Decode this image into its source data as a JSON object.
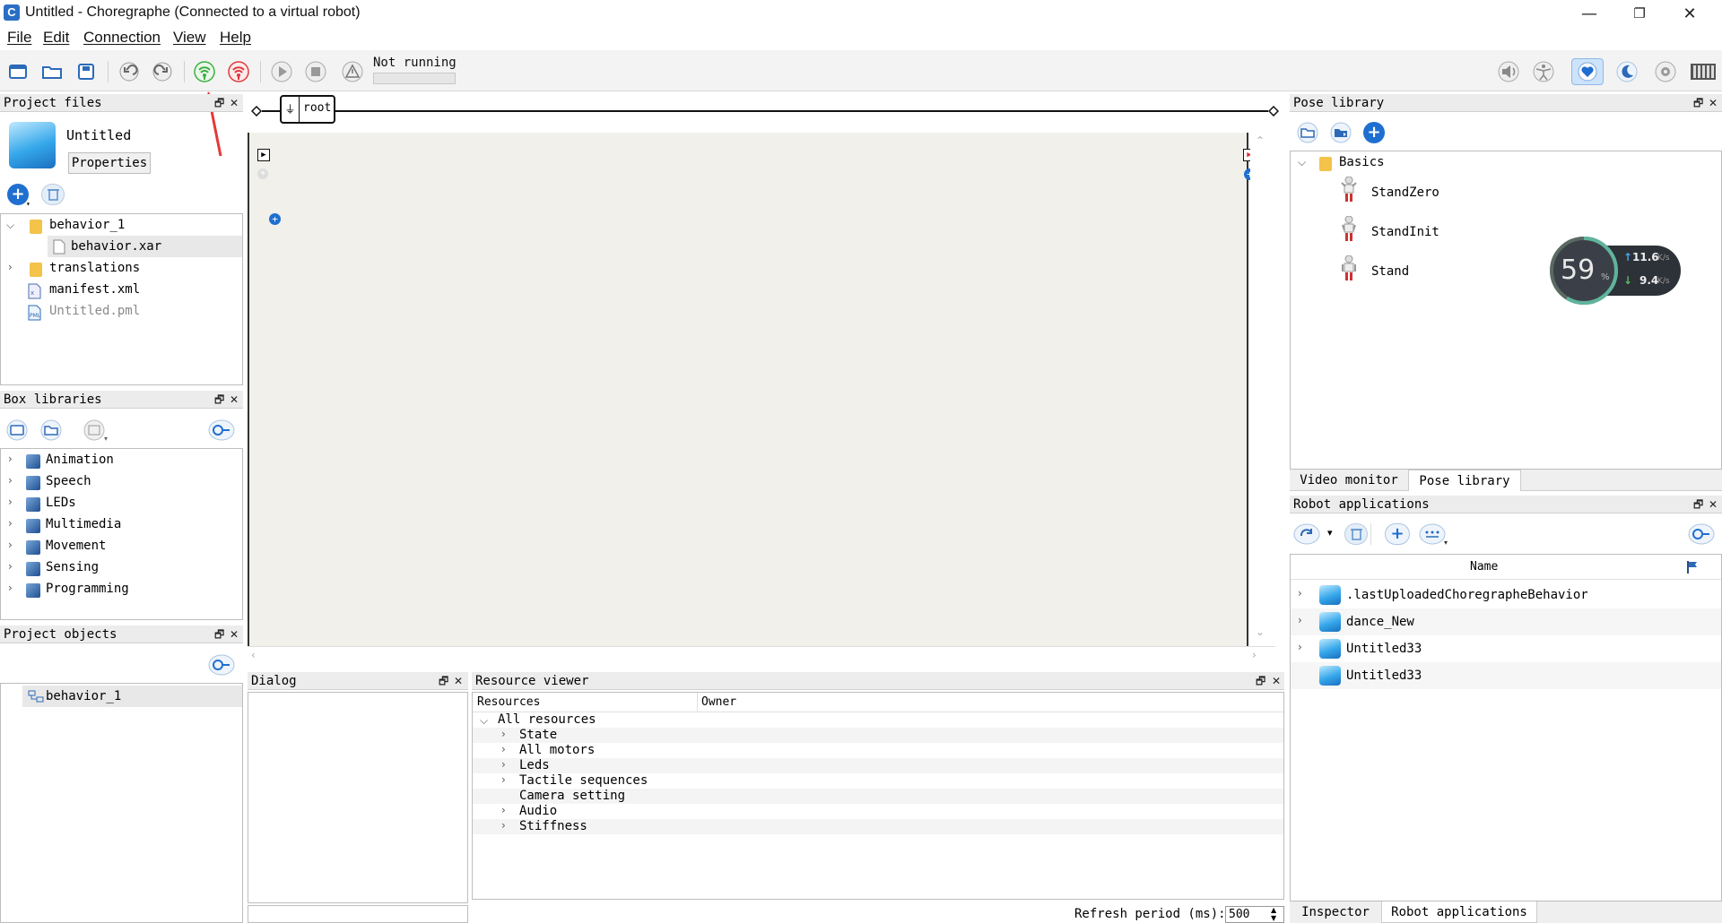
{
  "window": {
    "title": "Untitled - Choregraphe (Connected to a virtual robot)",
    "app_icon_letter": "C",
    "controls": {
      "minimize": "—",
      "maximize": "❐",
      "close": "✕"
    }
  },
  "menubar": {
    "items": [
      "File",
      "Edit",
      "Connection",
      "View",
      "Help"
    ]
  },
  "toolbar": {
    "status": "Not running",
    "progress": 0,
    "icons": [
      "new-project-icon",
      "open-project-icon",
      "save-project-icon",
      "undo-icon",
      "redo-icon",
      "connect-icon",
      "disconnect-icon",
      "play-icon",
      "stop-icon",
      "warning-icon",
      "volume-icon",
      "animation-mode-icon",
      "life-icon",
      "rest-icon",
      "settings-icon",
      "battery-icon"
    ]
  },
  "project_files": {
    "title": "Project files",
    "project_name": "Untitled",
    "properties_label": "Properties",
    "tree": [
      {
        "label": "behavior_1",
        "type": "folder",
        "expanded": true
      },
      {
        "label": "behavior.xar",
        "type": "file",
        "selected": true
      },
      {
        "label": "translations",
        "type": "folder",
        "expanded": false
      },
      {
        "label": "manifest.xml",
        "type": "xml"
      },
      {
        "label": "Untitled.pml",
        "type": "pml",
        "dim": true
      }
    ]
  },
  "box_libraries": {
    "title": "Box libraries",
    "items": [
      "Animation",
      "Speech",
      "LEDs",
      "Multimedia",
      "Movement",
      "Sensing",
      "Programming"
    ]
  },
  "project_objects": {
    "title": "Project objects",
    "items": [
      "behavior_1"
    ]
  },
  "flow": {
    "root_label": "root"
  },
  "dialog": {
    "title": "Dialog"
  },
  "resource_viewer": {
    "title": "Resource viewer",
    "columns": [
      "Resources",
      "Owner"
    ],
    "root": "All resources",
    "children": [
      {
        "label": "State",
        "expandable": true
      },
      {
        "label": "All motors",
        "expandable": true
      },
      {
        "label": "Leds",
        "expandable": true
      },
      {
        "label": "Tactile sequences",
        "expandable": true
      },
      {
        "label": "Camera setting",
        "expandable": false
      },
      {
        "label": "Audio",
        "expandable": true
      },
      {
        "label": "Stiffness",
        "expandable": true
      }
    ],
    "refresh_label": "Refresh period (ms):",
    "refresh_value": "500"
  },
  "pose_library": {
    "title": "Pose library",
    "folder": "Basics",
    "poses": [
      "StandZero",
      "StandInit",
      "Stand"
    ],
    "tabs": [
      "Video monitor",
      "Pose library"
    ]
  },
  "net_widget": {
    "percent": "59",
    "unit": "%",
    "up": "11.6",
    "down": "9.4",
    "rate_unit": "K/s"
  },
  "robot_applications": {
    "title": "Robot applications",
    "column": "Name",
    "apps": [
      ".lastUploadedChoregrapheBehavior",
      "dance_New",
      "Untitled33",
      "Untitled33"
    ],
    "tabs": [
      "Inspector",
      "Robot applications"
    ]
  },
  "colors": {
    "accent": "#1f6fd0",
    "selection": "#e8e8e8",
    "panel_header": "#ececec",
    "canvas": "#f1f0ea"
  }
}
